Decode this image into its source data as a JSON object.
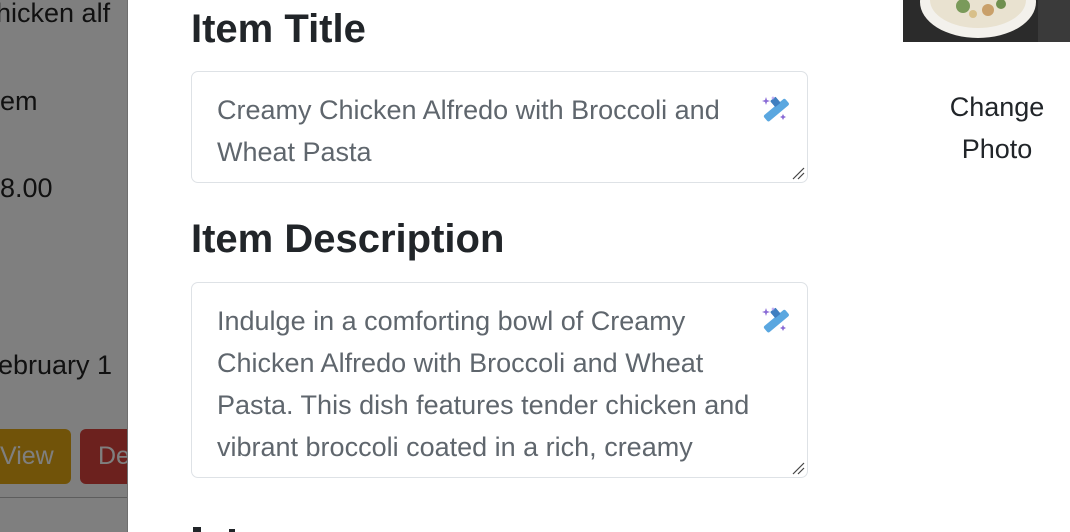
{
  "background_page": {
    "title_fragment": "hicken alf",
    "type_fragment": "em",
    "price_fragment": "8.00",
    "date_fragment": "ebruary 1",
    "view_button_label": "View",
    "delete_button_label": "De",
    "colors": {
      "view_button": "#e3a712",
      "delete_button": "#d9423c"
    }
  },
  "modal": {
    "title_label": "Item Title",
    "title_value": "Creamy Chicken Alfredo with Broccoli and Wheat Pasta",
    "description_label": "Item Description",
    "description_value": "Indulge in a comforting bowl of Creamy Chicken Alfredo with Broccoli and Wheat Pasta. This dish features tender chicken and vibrant broccoli coated in a rich, creamy Alfredo sauce, all served",
    "change_photo_label": "Change Photo",
    "icons": {
      "title_generate": "magic-wand-icon",
      "description_generate": "magic-wand-icon"
    }
  }
}
